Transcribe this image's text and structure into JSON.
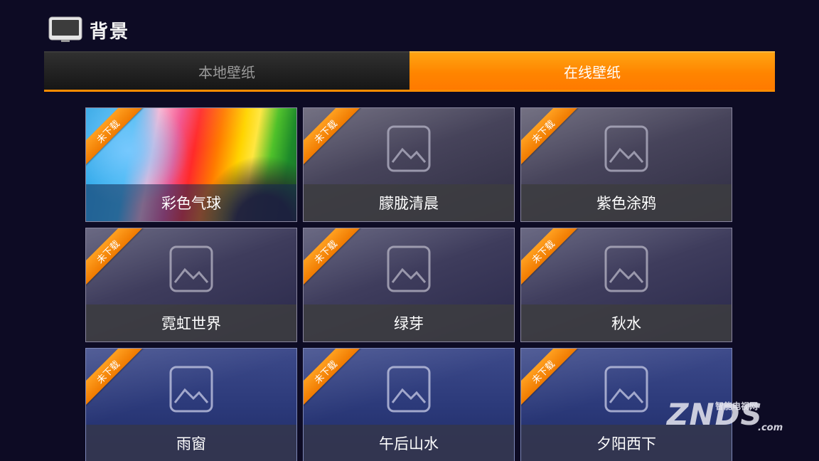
{
  "header": {
    "title": "背景",
    "icon": "tv-icon"
  },
  "tabs": [
    {
      "label": "本地壁纸",
      "selected": false
    },
    {
      "label": "在线壁纸",
      "selected": true
    }
  ],
  "wallpapers": [
    {
      "name": "彩色气球",
      "badge": "未下载",
      "has_preview": true
    },
    {
      "name": "朦胧清晨",
      "badge": "未下载",
      "has_preview": false
    },
    {
      "name": "紫色涂鸦",
      "badge": "未下载",
      "has_preview": false
    },
    {
      "name": "霓虹世界",
      "badge": "未下载",
      "has_preview": false
    },
    {
      "name": "绿芽",
      "badge": "未下载",
      "has_preview": false
    },
    {
      "name": "秋水",
      "badge": "未下载",
      "has_preview": false
    },
    {
      "name": "雨窗",
      "badge": "未下载",
      "has_preview": false
    },
    {
      "name": "午后山水",
      "badge": "未下载",
      "has_preview": false
    },
    {
      "name": "夕阳西下",
      "badge": "未下载",
      "has_preview": false
    }
  ],
  "watermark": {
    "brand": "ZNDS",
    "tagline": "智能电视网",
    "suffix": ".com"
  },
  "colors": {
    "accent": "#ff8c00",
    "background": "#0d0b24"
  }
}
